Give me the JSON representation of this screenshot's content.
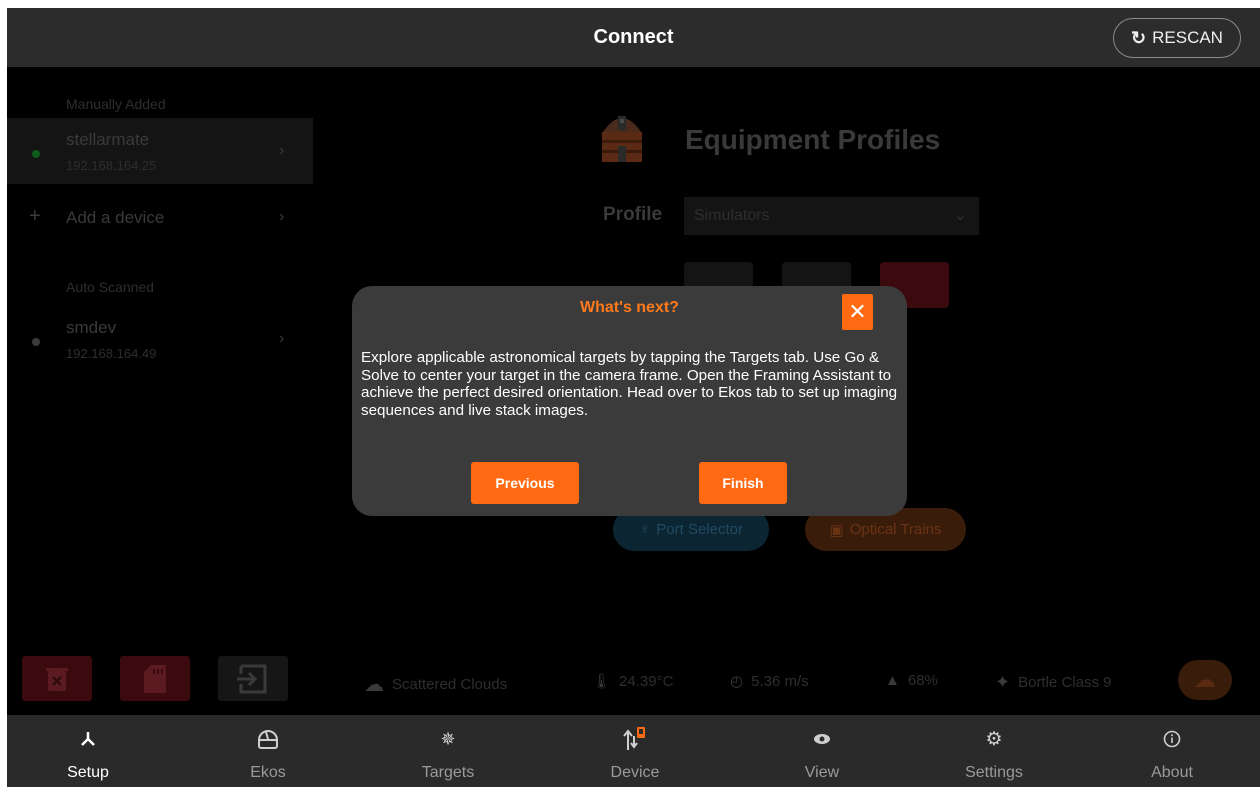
{
  "header": {
    "title": "Connect",
    "rescan_label": "RESCAN"
  },
  "devices": {
    "manual_label": "Manually Added",
    "manual": [
      {
        "name": "stellarmate",
        "ip": "192.168.164.25",
        "status_color": "#1a7a2a"
      }
    ],
    "add_label": "Add a device",
    "auto_label": "Auto Scanned",
    "auto": [
      {
        "name": "smdev",
        "ip": "192.168.164.49",
        "status_color": "#3a3a3a"
      }
    ]
  },
  "profiles": {
    "title": "Equipment Profiles",
    "profile_label": "Profile",
    "selected": "Simulators",
    "port_selector": "Port Selector",
    "optical_trains": "Optical Trains"
  },
  "weather": {
    "condition": "Scattered Clouds",
    "temperature": "24.39°C",
    "wind": "5.36 m/s",
    "humidity": "68%",
    "bortle": "Bortle Class 9"
  },
  "dialog": {
    "title": "What's next?",
    "body": "Explore applicable astronomical targets by tapping the Targets tab. Use Go & Solve to center your target in the camera frame. Open the Framing Assistant to achieve the perfect desired orientation. Head over to Ekos tab to set up imaging sequences and live stack images.",
    "previous_label": "Previous",
    "finish_label": "Finish"
  },
  "nav": {
    "items": [
      {
        "label": "Setup",
        "icon": "setup-icon"
      },
      {
        "label": "Ekos",
        "icon": "dome-icon"
      },
      {
        "label": "Targets",
        "icon": "target-icon"
      },
      {
        "label": "Device",
        "icon": "device-icon"
      },
      {
        "label": "View",
        "icon": "eye-icon"
      },
      {
        "label": "Settings",
        "icon": "gear-icon"
      },
      {
        "label": "About",
        "icon": "info-icon"
      }
    ],
    "active": "Setup"
  },
  "colors": {
    "accent": "#ff6a13",
    "dialog_bg": "#3b3b3b",
    "topbar_bg": "#2c2c2c"
  }
}
